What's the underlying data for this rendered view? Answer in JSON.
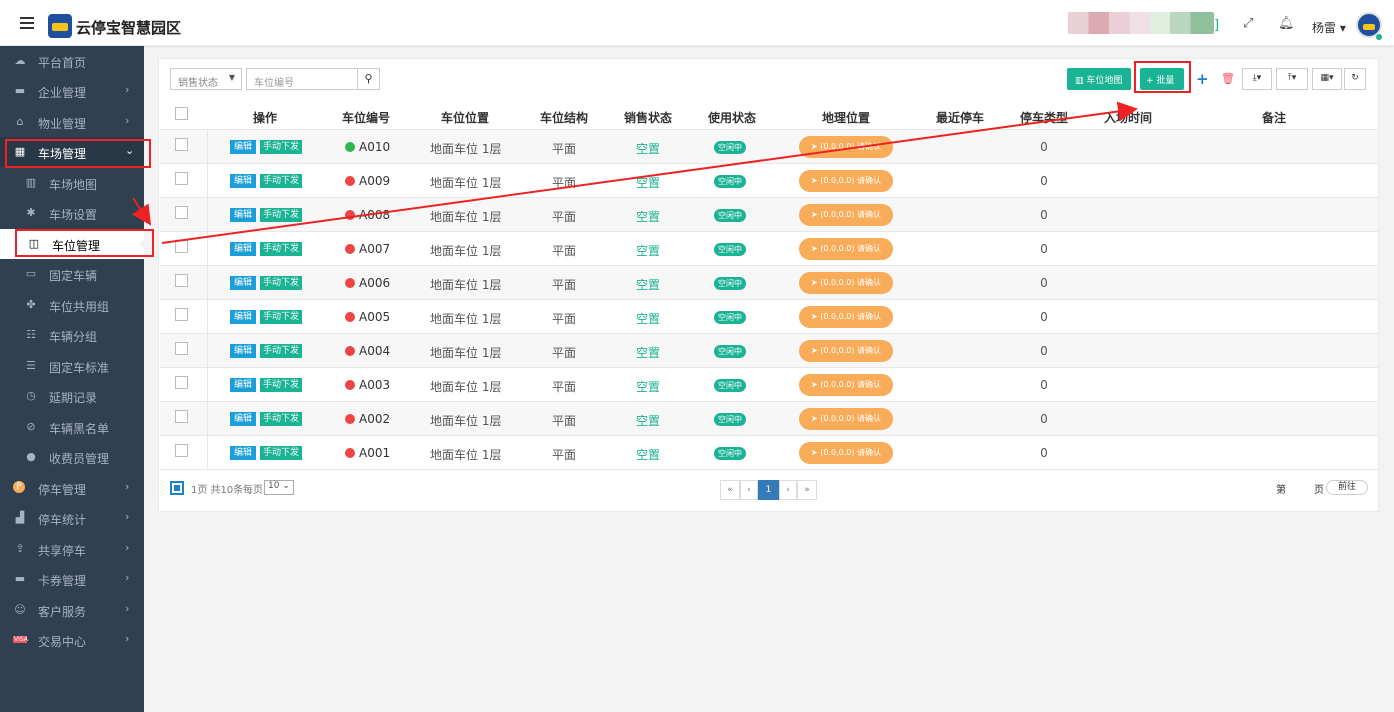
{
  "header": {
    "brand": "云停宝智慧园区",
    "bracket": "]",
    "user": "杨雷 ▾",
    "icons": [
      "menu-icon",
      "fullscreen-icon",
      "bell-icon",
      "avatar"
    ]
  },
  "sidebar": {
    "items": [
      {
        "label": "平台首页",
        "icon": "cloud-icon",
        "glyph": "☁"
      },
      {
        "label": "企业管理",
        "icon": "briefcase-icon",
        "glyph": "▬"
      },
      {
        "label": "物业管理",
        "icon": "home-icon",
        "glyph": "⌂"
      },
      {
        "label": "车场管理",
        "icon": "windows-icon",
        "glyph": "▦"
      },
      {
        "label": "车场地图",
        "icon": "map-icon",
        "glyph": "▥"
      },
      {
        "label": "车场设置",
        "icon": "gear-icon",
        "glyph": "✱"
      },
      {
        "label": "车位管理",
        "icon": "columns-icon",
        "glyph": "◫"
      },
      {
        "label": "固定车辆",
        "icon": "car-icon",
        "glyph": "▭"
      },
      {
        "label": "车位共用组",
        "icon": "cubes-icon",
        "glyph": "✤"
      },
      {
        "label": "车辆分组",
        "icon": "users-icon",
        "glyph": "☷"
      },
      {
        "label": "固定车标准",
        "icon": "list-icon",
        "glyph": "☰"
      },
      {
        "label": "延期记录",
        "icon": "clock-icon",
        "glyph": "◷"
      },
      {
        "label": "车辆黑名单",
        "icon": "ban-icon",
        "glyph": "⊘"
      },
      {
        "label": "收费员管理",
        "icon": "user-icon",
        "glyph": "●"
      },
      {
        "label": "停车管理",
        "icon": "parking-icon",
        "glyph": "P"
      },
      {
        "label": "停车统计",
        "icon": "bar-chart-icon",
        "glyph": "▟"
      },
      {
        "label": "共享停车",
        "icon": "share-icon",
        "glyph": "⇪"
      },
      {
        "label": "卡券管理",
        "icon": "credit-card-icon",
        "glyph": "▬"
      },
      {
        "label": "客户服务",
        "icon": "smile-icon",
        "glyph": "☺"
      },
      {
        "label": "交易中心",
        "icon": "visa-icon",
        "glyph": "VISA"
      }
    ]
  },
  "toolbar": {
    "sales_status_placeholder": "销售状态",
    "space_no_placeholder": "车位编号",
    "map_button": "车位地图",
    "batch_button": "+ 批量"
  },
  "table": {
    "columns": [
      "操作",
      "车位编号",
      "车位位置",
      "车位结构",
      "销售状态",
      "使用状态",
      "地理位置",
      "最近停车",
      "停车类型",
      "入场时间",
      "备注"
    ],
    "edit_label": "编辑",
    "issue_label": "手动下发",
    "rows": [
      {
        "id": "A010",
        "dot": "#2db84d",
        "location": "地面车位  1层",
        "structure": "平面",
        "sales": "空置",
        "usage": "空闲中",
        "geo": "(0.0,0.0) 请确认",
        "type": "0"
      },
      {
        "id": "A009",
        "dot": "#ed4545",
        "location": "地面车位  1层",
        "structure": "平面",
        "sales": "空置",
        "usage": "空闲中",
        "geo": "(0.0,0.0) 请确认",
        "type": "0"
      },
      {
        "id": "A008",
        "dot": "#ed4545",
        "location": "地面车位  1层",
        "structure": "平面",
        "sales": "空置",
        "usage": "空闲中",
        "geo": "(0.0,0.0) 请确认",
        "type": "0"
      },
      {
        "id": "A007",
        "dot": "#ed4545",
        "location": "地面车位  1层",
        "structure": "平面",
        "sales": "空置",
        "usage": "空闲中",
        "geo": "(0.0,0.0) 请确认",
        "type": "0"
      },
      {
        "id": "A006",
        "dot": "#ed4545",
        "location": "地面车位  1层",
        "structure": "平面",
        "sales": "空置",
        "usage": "空闲中",
        "geo": "(0.0,0.0) 请确认",
        "type": "0"
      },
      {
        "id": "A005",
        "dot": "#ed4545",
        "location": "地面车位  1层",
        "structure": "平面",
        "sales": "空置",
        "usage": "空闲中",
        "geo": "(0.0,0.0) 请确认",
        "type": "0"
      },
      {
        "id": "A004",
        "dot": "#ed4545",
        "location": "地面车位  1层",
        "structure": "平面",
        "sales": "空置",
        "usage": "空闲中",
        "geo": "(0.0,0.0) 请确认",
        "type": "0"
      },
      {
        "id": "A003",
        "dot": "#ed4545",
        "location": "地面车位  1层",
        "structure": "平面",
        "sales": "空置",
        "usage": "空闲中",
        "geo": "(0.0,0.0) 请确认",
        "type": "0"
      },
      {
        "id": "A002",
        "dot": "#ed4545",
        "location": "地面车位  1层",
        "structure": "平面",
        "sales": "空置",
        "usage": "空闲中",
        "geo": "(0.0,0.0) 请确认",
        "type": "0"
      },
      {
        "id": "A001",
        "dot": "#ed4545",
        "location": "地面车位  1层",
        "structure": "平面",
        "sales": "空置",
        "usage": "空闲中",
        "geo": "(0.0,0.0) 请确认",
        "type": "0"
      }
    ]
  },
  "footer": {
    "summary": "1页 共10条",
    "per_page_label": "每页",
    "per_page_value": "10",
    "pages": [
      "«",
      "‹",
      "1",
      "›",
      "»"
    ],
    "current_page": "1",
    "page_prefix": "第",
    "page_suffix": "页",
    "goto": "前往"
  },
  "colors": {
    "sidebar_bg": "#2f4050",
    "accent_green": "#1ab394",
    "accent_blue": "#1c84c6",
    "warn_orange": "#f8ac59",
    "annotation_red": "#e22222"
  }
}
